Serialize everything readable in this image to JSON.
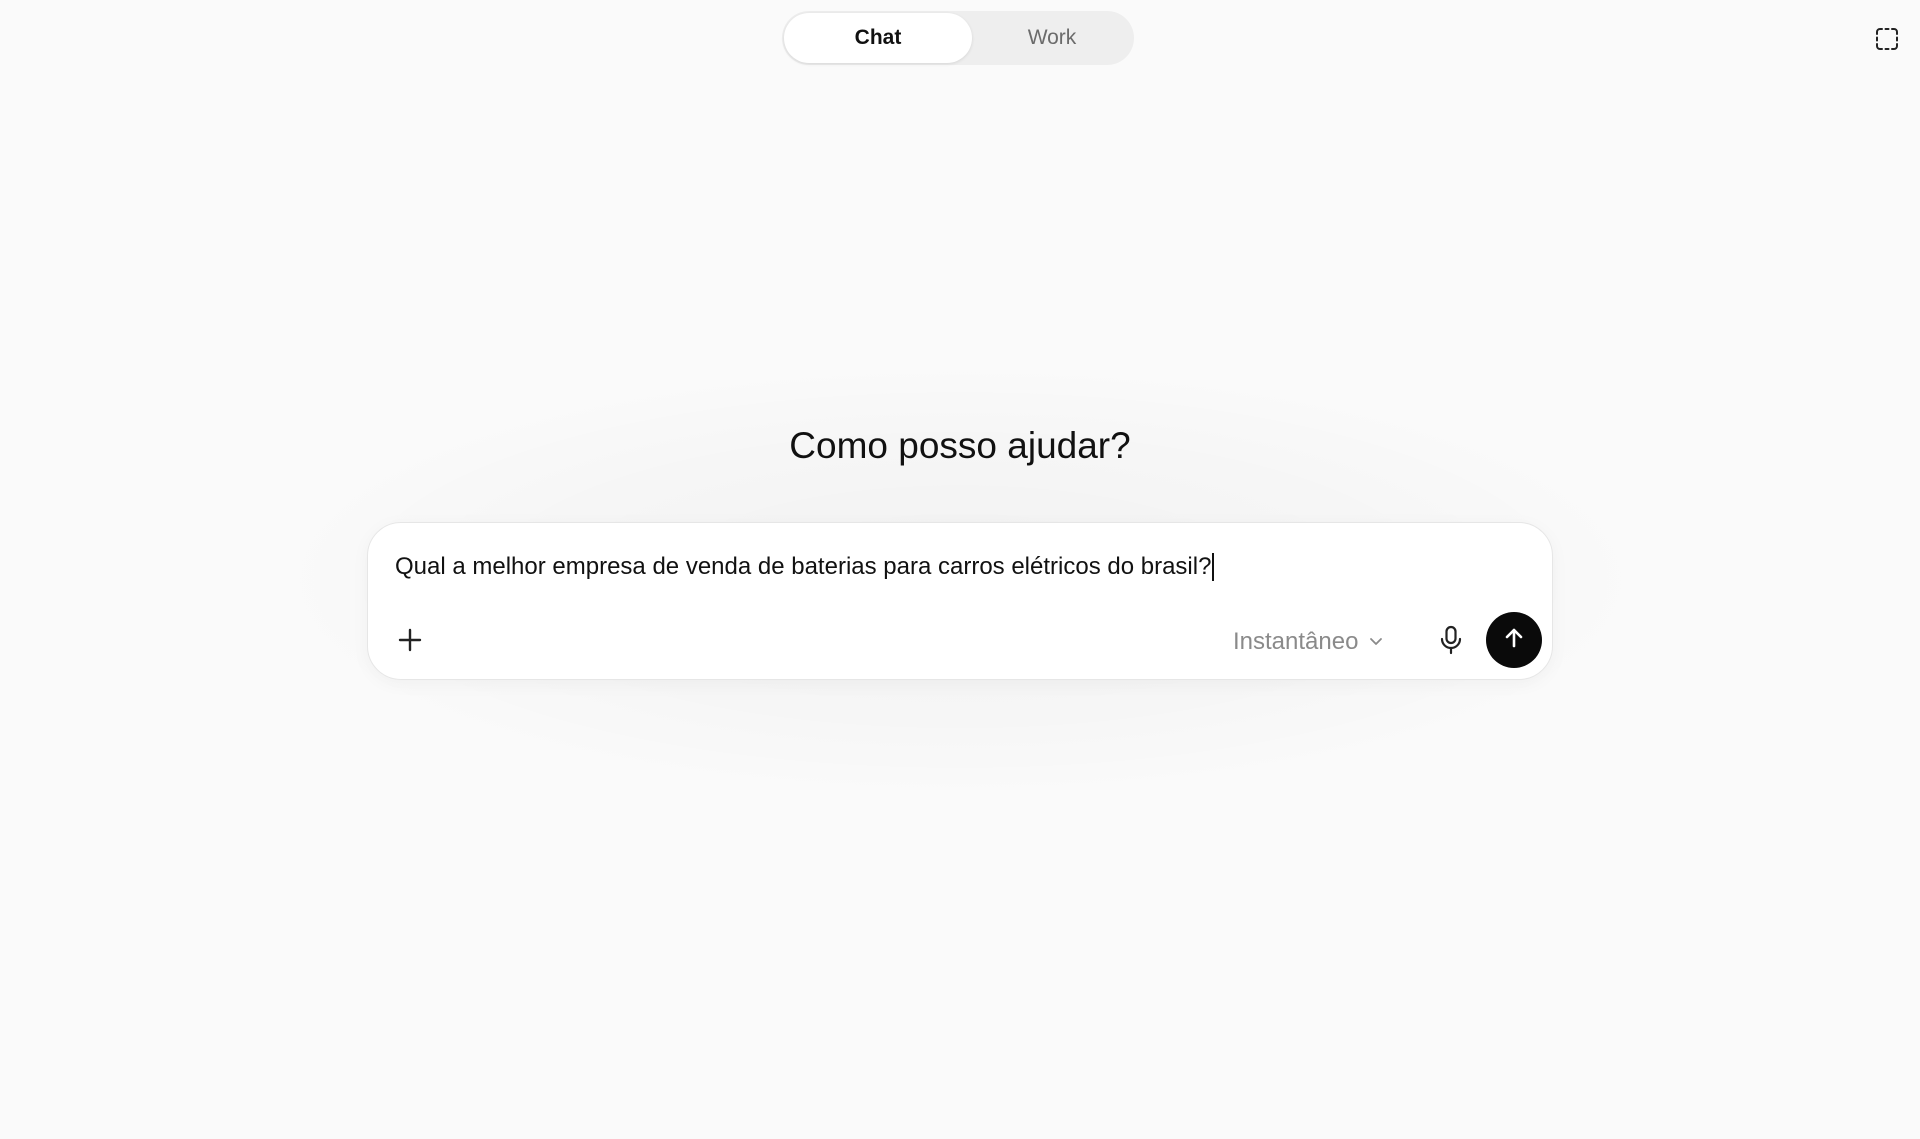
{
  "mode_toggle": {
    "active_label": "Chat",
    "inactive_label": "Work"
  },
  "top_right": {
    "icon": "dashed-square-icon"
  },
  "main": {
    "heading": "Como posso ajudar?"
  },
  "composer": {
    "input_value": "Qual a melhor empresa de venda de baterias para carros elétricos do brasil?",
    "add_icon": "plus-icon",
    "model_label": "Instantâneo",
    "model_icon": "chevron-down-icon",
    "mic_icon": "microphone-icon",
    "send_icon": "arrow-up-icon"
  },
  "colors": {
    "background": "#fafafa",
    "send_button": "#0a0a0a",
    "muted_text": "#8a8a8a"
  }
}
